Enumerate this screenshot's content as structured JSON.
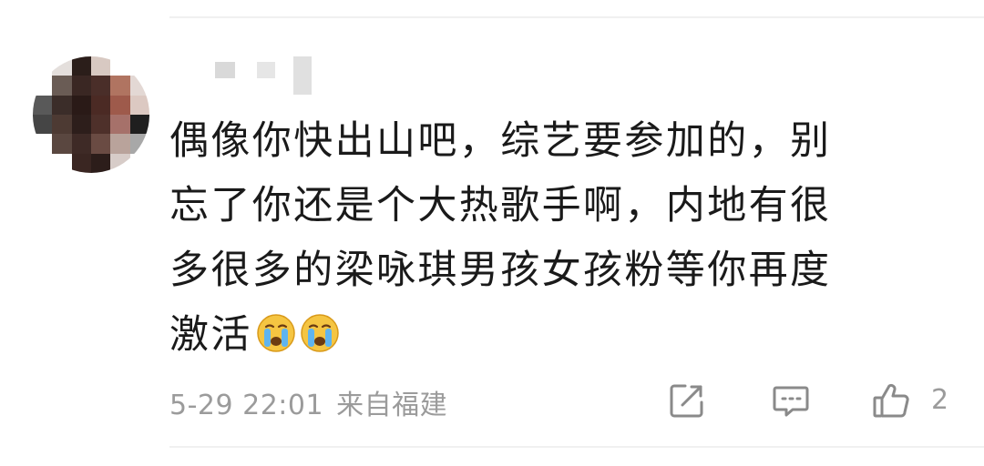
{
  "comment": {
    "lines": [
      "偶像你快出山吧，综艺要参加的，别",
      "忘了你还是个大热歌手啊，内地有很",
      "多很多的梁咏琪男孩女孩粉等你再度",
      "激活"
    ],
    "emoji": [
      "crying-face-emoji",
      "crying-face-emoji"
    ]
  },
  "meta": {
    "datetime": "5-29 22:01",
    "location": "来自福建"
  },
  "actions": {
    "share_icon": "share-icon",
    "reply_icon": "comment-icon",
    "like_icon": "thumbs-up-icon",
    "like_count": "2"
  },
  "colors": {
    "text": "#1a1a1a",
    "secondary": "#9b9b9b",
    "divider": "#f0f0f0"
  }
}
